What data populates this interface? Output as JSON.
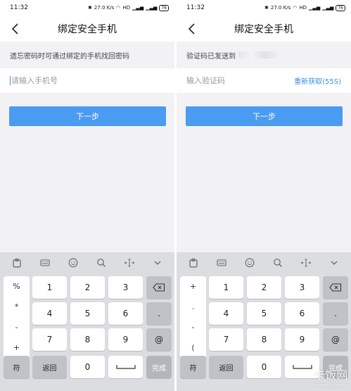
{
  "status": {
    "time": "11:32",
    "icons": [
      "bluetooth-icon",
      "speed-icon",
      "wifi-icon",
      "hd-icon",
      "signal1-icon",
      "signal2-icon"
    ],
    "net_speed": "27.0 K/s",
    "battery": "76"
  },
  "left": {
    "title": "绑定安全手机",
    "hint": "遗忘密码时可通过绑定的手机找回密码",
    "phone_placeholder": "请输入手机号",
    "next_label": "下一步"
  },
  "right": {
    "title": "绑定安全手机",
    "hint": "验证码已发送到",
    "code_placeholder": "输入验证码",
    "resend_label": "重新获取(55S)",
    "next_label": "下一步"
  },
  "keyboard": {
    "left_side": [
      "%",
      "*",
      "-",
      "+"
    ],
    "right_side": [
      "+",
      ".",
      "-",
      "("
    ],
    "digits": [
      "1",
      "2",
      "3",
      "4",
      "5",
      "6",
      "7",
      "8",
      "9",
      "0"
    ],
    "dot": ".",
    "at": "@",
    "fu": "符",
    "fanhui": "返回",
    "wancheng": "完成"
  },
  "watermark": {
    "main": "卡饭网",
    "sub": "www.kafan.cn"
  },
  "colors": {
    "accent": "#4a9cf0",
    "link": "#3a8ee6",
    "keyboard_bg": "#dcdde1",
    "page_bg": "#f2f2f4"
  }
}
